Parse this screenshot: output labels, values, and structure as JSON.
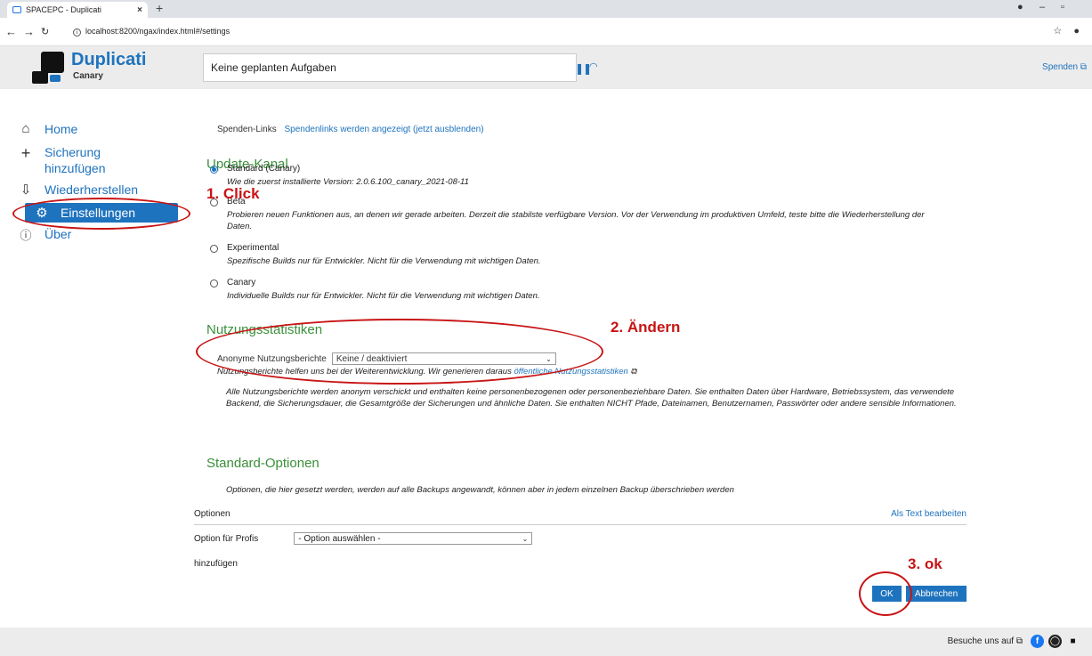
{
  "browser": {
    "tab_title": "SPACEPC - Duplicati",
    "tab_close": "×",
    "new_tab": "+",
    "url": "localhost:8200/ngax/index.html#/settings"
  },
  "header": {
    "brand": "Duplicati",
    "sub": "Canary",
    "status": "Keine geplanten Aufgaben",
    "spenden": "Spenden"
  },
  "sidebar": {
    "items": [
      {
        "label": "Home",
        "icon": "home-icon"
      },
      {
        "label": "Sicherung hinzufügen",
        "icon": "plus-icon"
      },
      {
        "label": "Wiederherstellen",
        "icon": "restore-icon"
      },
      {
        "label": "Einstellungen",
        "icon": "gear-icon"
      },
      {
        "label": "Über",
        "icon": "info-icon"
      }
    ]
  },
  "donation": {
    "label": "Spenden-Links",
    "link": "Spendenlinks werden angezeigt (jetzt ausblenden)"
  },
  "update_channel": {
    "title": "Update-Kanal",
    "options": [
      {
        "title": "Standard (Canary)",
        "desc": "Wie die zuerst installierte Version: 2.0.6.100_canary_2021-08-11"
      },
      {
        "title": "Beta",
        "desc": "Probieren neuen Funktionen aus, an denen wir gerade arbeiten. Derzeit die stabilste verfügbare Version. Vor der Verwendung im produktiven Umfeld, teste bitte die Wiederherstellung der Daten."
      },
      {
        "title": "Experimental",
        "desc": "Spezifische Builds nur für Entwickler. Nicht für die Verwendung mit wichtigen Daten."
      },
      {
        "title": "Canary",
        "desc": "Individuelle Builds nur für Entwickler. Nicht für die Verwendung mit wichtigen Daten."
      }
    ]
  },
  "usage": {
    "title": "Nutzungsstatistiken",
    "label": "Anonyme Nutzungsberichte",
    "selected": "Keine / deaktiviert",
    "desc": "Nutzungsberichte helfen uns bei der Weiterentwicklung. Wir generieren daraus",
    "desc_link": "öffentliche Nutzungsstatistiken",
    "long": "Alle Nutzungsberichte werden anonym verschickt und enthalten keine personenbezogenen oder personenbeziehbare Daten. Sie enthalten Daten über Hardware, Betriebssystem, das verwendete Backend, die Sicherungsdauer, die Gesamtgröße der Sicherungen und ähnliche Daten. Sie enthalten NICHT Pfade, Dateinamen, Benutzernamen, Passwörter oder andere sensible Informationen."
  },
  "standard_options": {
    "title": "Standard-Optionen",
    "desc": "Optionen, die hier gesetzt werden, werden auf alle Backups angewandt, können aber in jedem einzelnen Backup überschrieben werden",
    "options_label": "Optionen",
    "edit_text": "Als Text bearbeiten",
    "profile_label": "Option für Profis",
    "profile_select": "- Option auswählen -",
    "add_label": "hinzufügen"
  },
  "buttons": {
    "ok": "OK",
    "cancel": "Abbrechen"
  },
  "annotations": {
    "a1": "1. Click",
    "a2": "2. Ändern",
    "a3": "3. ok"
  },
  "footer": {
    "text": "Besuche uns auf"
  }
}
